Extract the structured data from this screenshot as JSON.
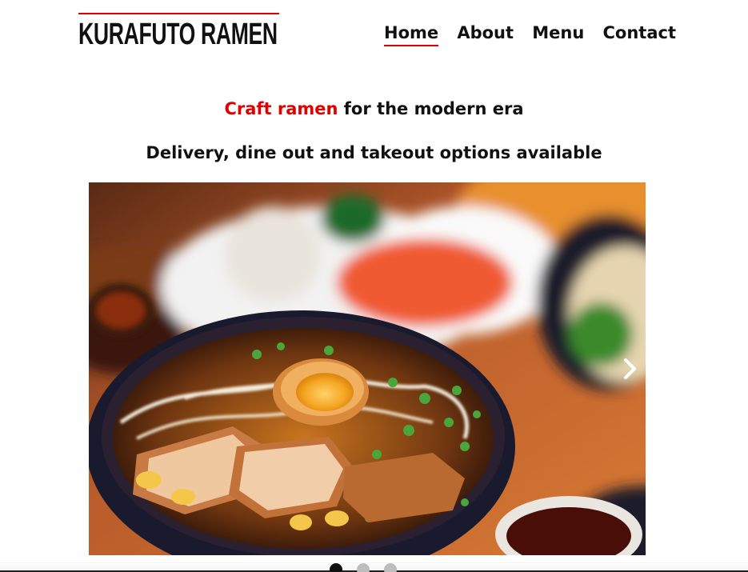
{
  "brand": {
    "name": "KURAFUTO RAMEN",
    "accent_color": "#e00000"
  },
  "nav": {
    "items": [
      {
        "label": "Home",
        "active": true
      },
      {
        "label": "About",
        "active": false
      },
      {
        "label": "Menu",
        "active": false
      },
      {
        "label": "Contact",
        "active": false
      }
    ]
  },
  "hero": {
    "headline_accent": "Craft ramen",
    "headline_rest": " for the modern era",
    "subline": "Delivery, dine out and takeout options available"
  },
  "carousel": {
    "image_alt": "ramen-bowl-photo",
    "next_icon": "chevron-right-icon",
    "slide_count": 3,
    "active_index": 0
  }
}
